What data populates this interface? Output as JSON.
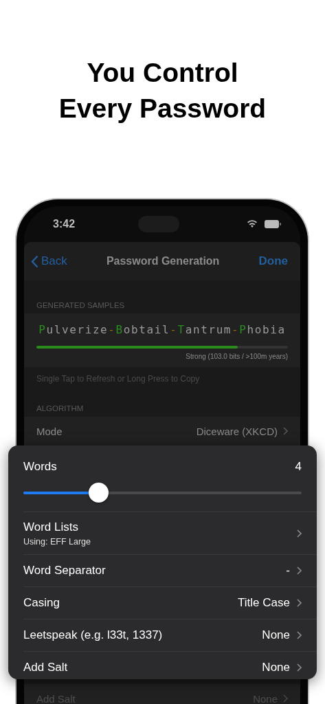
{
  "headline": "You Control Every Password",
  "status_bar": {
    "time": "3:42"
  },
  "nav": {
    "back": "Back",
    "title": "Password Generation",
    "done": "Done"
  },
  "samples": {
    "header": "GENERATED SAMPLES",
    "password": [
      {
        "text": "P",
        "kind": "initial"
      },
      {
        "text": "ulverize",
        "kind": "rest"
      },
      {
        "text": "-",
        "kind": "separator"
      },
      {
        "text": "B",
        "kind": "initial"
      },
      {
        "text": "obtail",
        "kind": "rest"
      },
      {
        "text": "-",
        "kind": "separator"
      },
      {
        "text": "T",
        "kind": "initial"
      },
      {
        "text": "antrum",
        "kind": "rest"
      },
      {
        "text": "-",
        "kind": "separator"
      },
      {
        "text": "P",
        "kind": "initial"
      },
      {
        "text": "hobia",
        "kind": "rest"
      }
    ],
    "strength": {
      "level": 0.8,
      "label": "Strong (103.0 bits / >100m years)"
    },
    "footer": "Single Tap to Refresh or Long Press to Copy"
  },
  "algorithm": {
    "header": "ALGORITHM",
    "mode": {
      "label": "Mode",
      "value": "Diceware (XKCD)"
    }
  },
  "background_row": {
    "label": "Add Salt",
    "value": "None"
  },
  "panel": {
    "words": {
      "label": "Words",
      "value": "4",
      "level": 0.27
    },
    "rows": [
      {
        "label": "Word Lists",
        "subtitle": "Using: EFF Large"
      },
      {
        "label": "Word Separator",
        "value": "-"
      },
      {
        "label": "Casing",
        "value": "Title Case"
      },
      {
        "label": "Leetspeak (e.g. l33t, 1337)",
        "value": "None"
      },
      {
        "label": "Add Salt",
        "value": "None"
      }
    ]
  }
}
